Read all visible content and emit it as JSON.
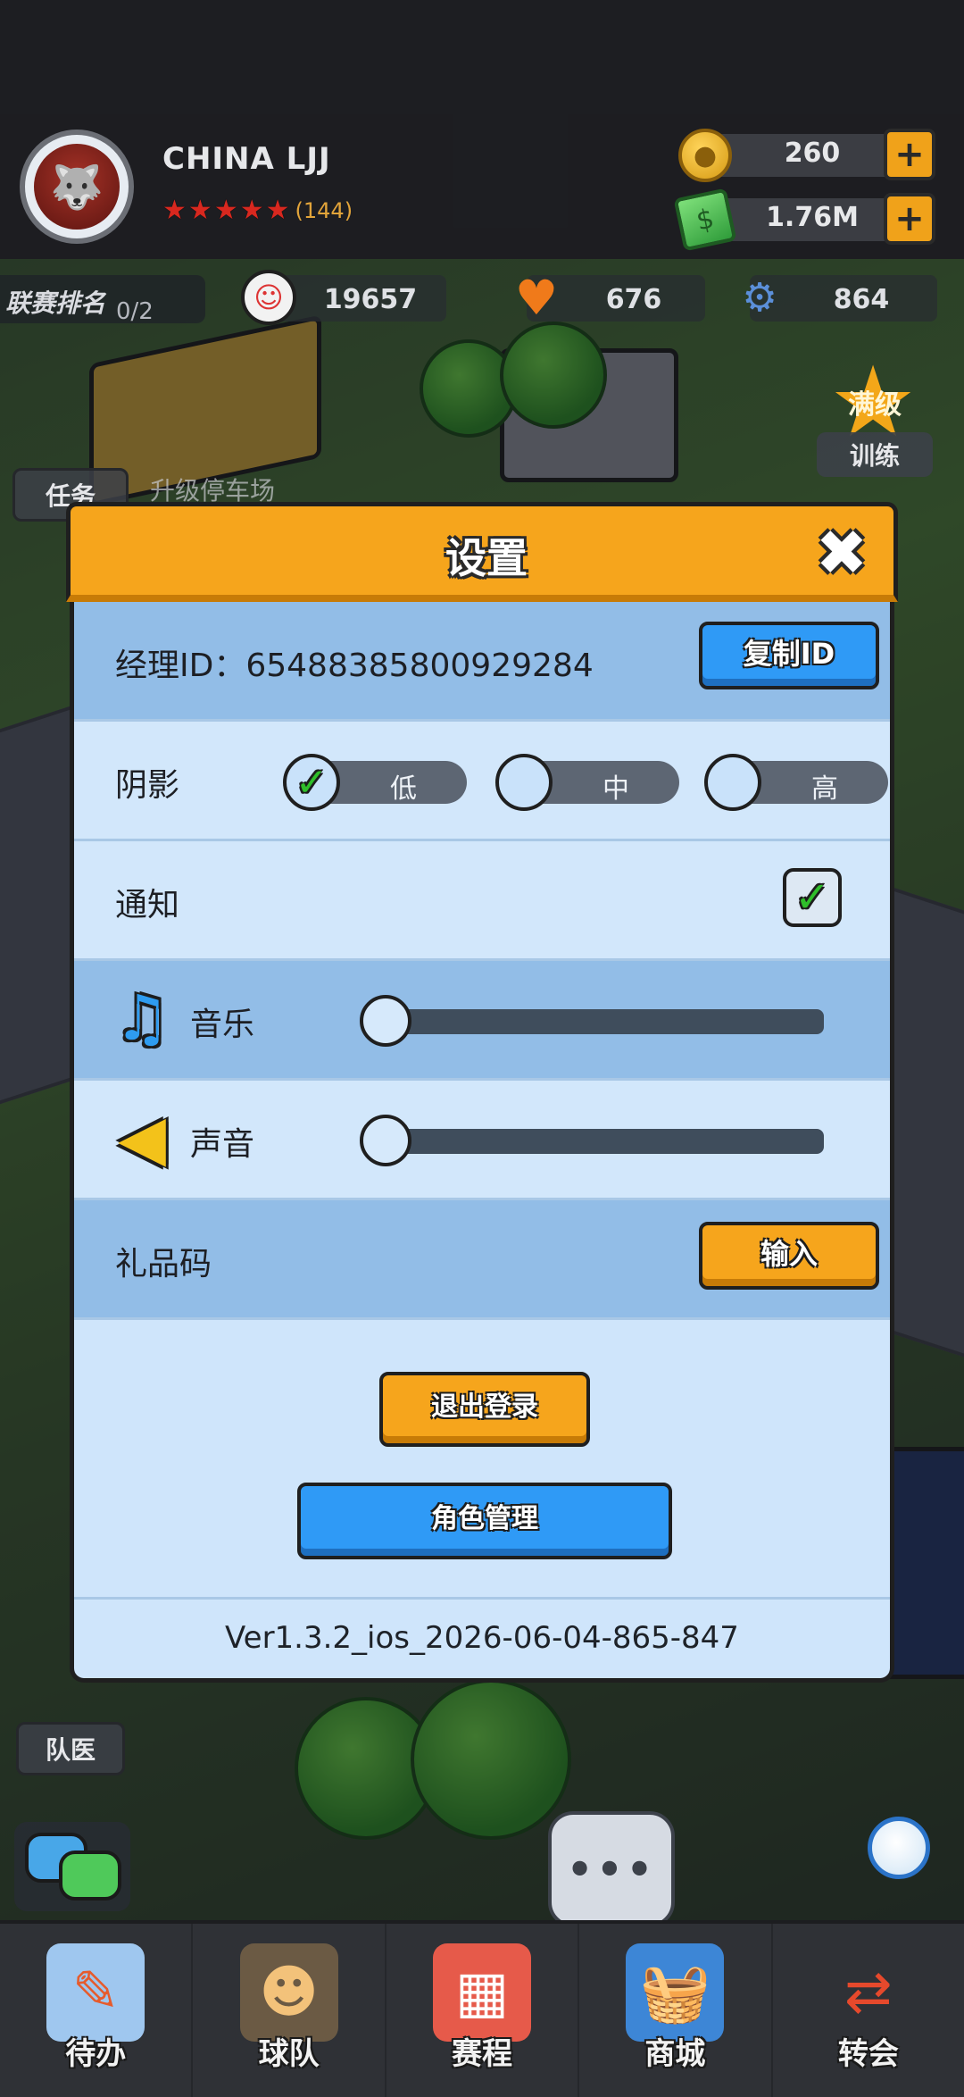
{
  "player": {
    "name": "CHINA LJJ",
    "star_count_label": "(144)",
    "stars": 5
  },
  "currency": {
    "coins": "260",
    "cash": "1.76M"
  },
  "stats": {
    "league_title": "联赛排名",
    "league_progress": "0/2",
    "stat1": "19657",
    "stat2": "676",
    "stat3": "864"
  },
  "side": {
    "task": "任务",
    "upgrade_parking": "升级停车场",
    "max_level": "满级",
    "training": "训练",
    "doctor": "队医"
  },
  "settings": {
    "title": "设置",
    "manager_id_label": "经理ID：",
    "manager_id_value": "65488385800929284",
    "copy_id": "复制ID",
    "shadow_label": "阴影",
    "shadow_options": [
      "低",
      "中",
      "高"
    ],
    "shadow_selected": "低",
    "notify_label": "通知",
    "notify_checked": true,
    "music_label": "音乐",
    "music_level": 0,
    "sound_label": "声音",
    "sound_level": 0,
    "gift_label": "礼品码",
    "gift_input": "输入",
    "logout": "退出登录",
    "role_manage": "角色管理",
    "version": "Ver1.3.2_ios_2026-06-04-865-847"
  },
  "nav": [
    "待办",
    "球队",
    "赛程",
    "商城",
    "转会"
  ],
  "colors": {
    "header": "#f6a51c",
    "panel": "#cfe5fb",
    "row_dark": "#92bde7",
    "blue_button": "#2f9af6",
    "check": "#2fbe2a"
  },
  "icons": {
    "close": "close-icon",
    "check": "check-icon",
    "music": "music-note-icon",
    "sound": "speaker-icon",
    "coin": "coin-icon",
    "cash": "cash-icon",
    "plus": "plus-icon"
  }
}
